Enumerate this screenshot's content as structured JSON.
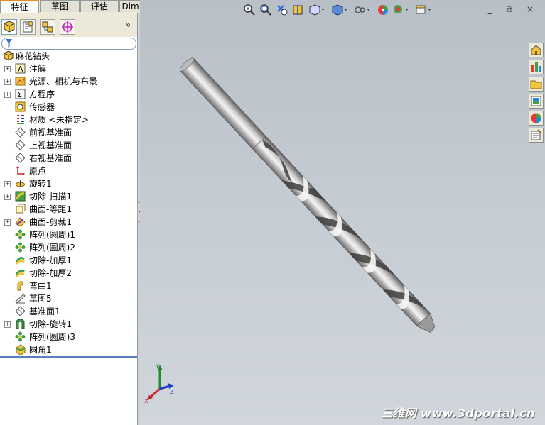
{
  "tabs": [
    {
      "label": "特征",
      "active": true
    },
    {
      "label": "草图",
      "active": false
    },
    {
      "label": "评估",
      "active": false
    },
    {
      "label": "DimXpert",
      "active": false
    }
  ],
  "panel_collapse_glyph": "»",
  "tree": {
    "root": "麻花钻头",
    "items": [
      {
        "label": "注解",
        "icon": "annotation-icon",
        "expandable": true
      },
      {
        "label": "光源、相机与布景",
        "icon": "lights-cameras-icon",
        "expandable": true
      },
      {
        "label": "方程序",
        "icon": "equations-icon",
        "expandable": true
      },
      {
        "label": "传感器",
        "icon": "sensor-icon",
        "expandable": false
      },
      {
        "label": "材质 <未指定>",
        "icon": "material-icon",
        "expandable": false
      },
      {
        "label": "前视基准面",
        "icon": "plane-icon",
        "expandable": false
      },
      {
        "label": "上视基准面",
        "icon": "plane-icon",
        "expandable": false
      },
      {
        "label": "右视基准面",
        "icon": "plane-icon",
        "expandable": false
      },
      {
        "label": "原点",
        "icon": "origin-icon",
        "expandable": false
      },
      {
        "label": "旋转1",
        "icon": "revolve-icon",
        "expandable": true
      },
      {
        "label": "切除-扫描1",
        "icon": "cut-sweep-icon",
        "expandable": true
      },
      {
        "label": "曲面-等距1",
        "icon": "offset-surface-icon",
        "expandable": false
      },
      {
        "label": "曲面-剪裁1",
        "icon": "trim-surface-icon",
        "expandable": true
      },
      {
        "label": "阵列(圆周)1",
        "icon": "circular-pattern-icon",
        "expandable": false
      },
      {
        "label": "阵列(圆周)2",
        "icon": "circular-pattern-icon",
        "expandable": false
      },
      {
        "label": "切除-加厚1",
        "icon": "thicken-cut-icon",
        "expandable": false
      },
      {
        "label": "切除-加厚2",
        "icon": "thicken-cut-icon",
        "expandable": false
      },
      {
        "label": "弯曲1",
        "icon": "flex-icon",
        "expandable": false
      },
      {
        "label": "草图5",
        "icon": "sketch-icon",
        "expandable": false
      },
      {
        "label": "基准面1",
        "icon": "plane-icon",
        "expandable": false
      },
      {
        "label": "切除-旋转1",
        "icon": "cut-revolve-icon",
        "expandable": true
      },
      {
        "label": "阵列(圆周)3",
        "icon": "circular-pattern-icon",
        "expandable": false
      },
      {
        "label": "圆角1",
        "icon": "fillet-icon",
        "expandable": false
      }
    ]
  },
  "window_controls": "_ ⧉ ×",
  "triad_labels": {
    "x": "X",
    "y": "Y",
    "z": "Z"
  },
  "watermark": "三维网 www.3dportal.cn",
  "colors": {
    "viewport_top": "#b8bfc7",
    "viewport_bottom": "#d0d6db",
    "tab_accent": "#e68b2c"
  }
}
